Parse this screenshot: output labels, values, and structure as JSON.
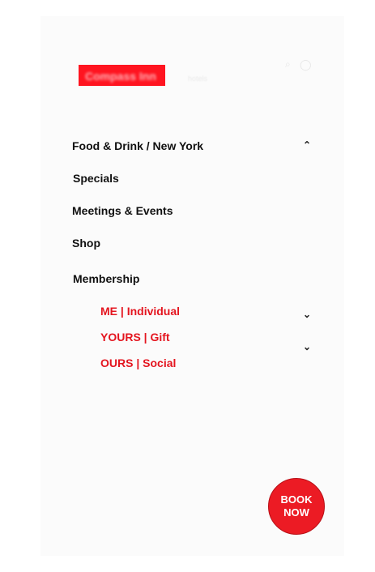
{
  "header": {
    "logo_text": "Compass Inn",
    "tagline": "hotels",
    "icons": [
      "search-icon",
      "user-icon"
    ]
  },
  "nav": {
    "items": [
      {
        "label": "Food & Drink / New York",
        "expanded": true
      },
      {
        "label": "Specials"
      },
      {
        "label": "Meetings & Events"
      },
      {
        "label": "Shop"
      },
      {
        "label": "Membership"
      }
    ],
    "membership_sub": [
      {
        "label": "ME | Individual"
      },
      {
        "label": "YOURS | Gift"
      },
      {
        "label": "OURS | Social"
      }
    ]
  },
  "book_button": {
    "line1": "BOOK",
    "line2": "NOW"
  },
  "colors": {
    "accent": "#ec1b24",
    "submenu_text": "#e4151f",
    "panel_bg": "#fbfbfb"
  }
}
